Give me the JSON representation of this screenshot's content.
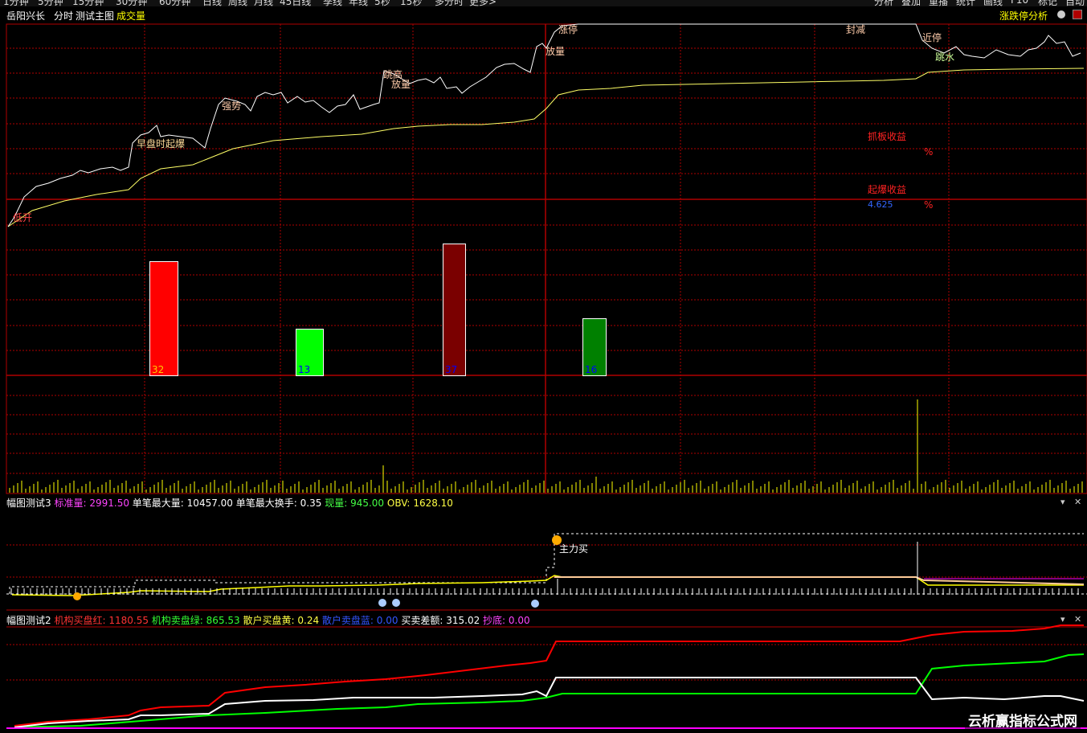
{
  "toolbar": {
    "items": [
      "1分钟",
      "5分钟",
      "15分钟",
      "30分钟",
      "60分钟",
      "日线",
      "周线",
      "月线",
      "45日线",
      "季线",
      "年线",
      "5秒",
      "15秒",
      "多分时",
      "更多>"
    ],
    "right_items": [
      "分析",
      "叠加",
      "重播",
      "统计",
      "画线",
      "F10",
      "标记",
      "自动"
    ]
  },
  "main_header": {
    "stock": "岳阳兴长",
    "mode": "分时",
    "indicator": "测试主图",
    "volume": "成交量",
    "right_label": "涨跌停分析"
  },
  "annotations": {
    "start": "低开",
    "burst": "早盘时起爆",
    "strong": "强势",
    "jump_high": "跳高",
    "vol1": "放量",
    "vol2": "放量",
    "limit_up": "涨停",
    "seal_down": "封减",
    "near_limit": "近停",
    "jump_water": "跳水"
  },
  "profit": {
    "grab_title": "抓板收益",
    "grab_pct": "%",
    "burst_title": "起爆收益",
    "burst_value": "4.625",
    "burst_pct": "%"
  },
  "bars": [
    {
      "value": 32,
      "color": "#ff0000",
      "label_color": "#ffcc00"
    },
    {
      "value": 13,
      "color": "#00ff00",
      "label_color": "#0000ff"
    },
    {
      "value": 37,
      "color": "#7a0000",
      "label_color": "#0000ff"
    },
    {
      "value": 16,
      "color": "#008000",
      "label_color": "#0000ff"
    }
  ],
  "panel3": {
    "title": "幅图测试3",
    "std_vol_label": "标准量:",
    "std_vol": "2991.50",
    "max_single_label": "单笔最大量:",
    "max_single": "10457.00",
    "max_turn_label": "单笔最大换手:",
    "max_turn": "0.35",
    "cur_vol_label": "现量:",
    "cur_vol": "945.00",
    "obv_label": "OBV:",
    "obv": "1628.10",
    "main_buy": "主力买"
  },
  "panel2": {
    "title": "幅图测试2",
    "inst_buy_label": "机构买盘红:",
    "inst_buy": "1180.55",
    "inst_sell_label": "机构卖盘绿:",
    "inst_sell": "865.53",
    "retail_buy_label": "散户买盘黄:",
    "retail_buy": "0.24",
    "retail_sell_label": "散户卖盘蓝:",
    "retail_sell": "0.00",
    "diff_label": "买卖差额:",
    "diff": "315.02",
    "bottom_label": "抄底:",
    "bottom": "0.00"
  },
  "watermark": "云析赢指标公式网",
  "colors": {
    "grid": "#b00000",
    "price": "#ffffff",
    "avg": "#ffff66",
    "red": "#ff0000",
    "green": "#00ff00",
    "magenta": "#ff00ff",
    "yellow": "#ffff00"
  }
}
